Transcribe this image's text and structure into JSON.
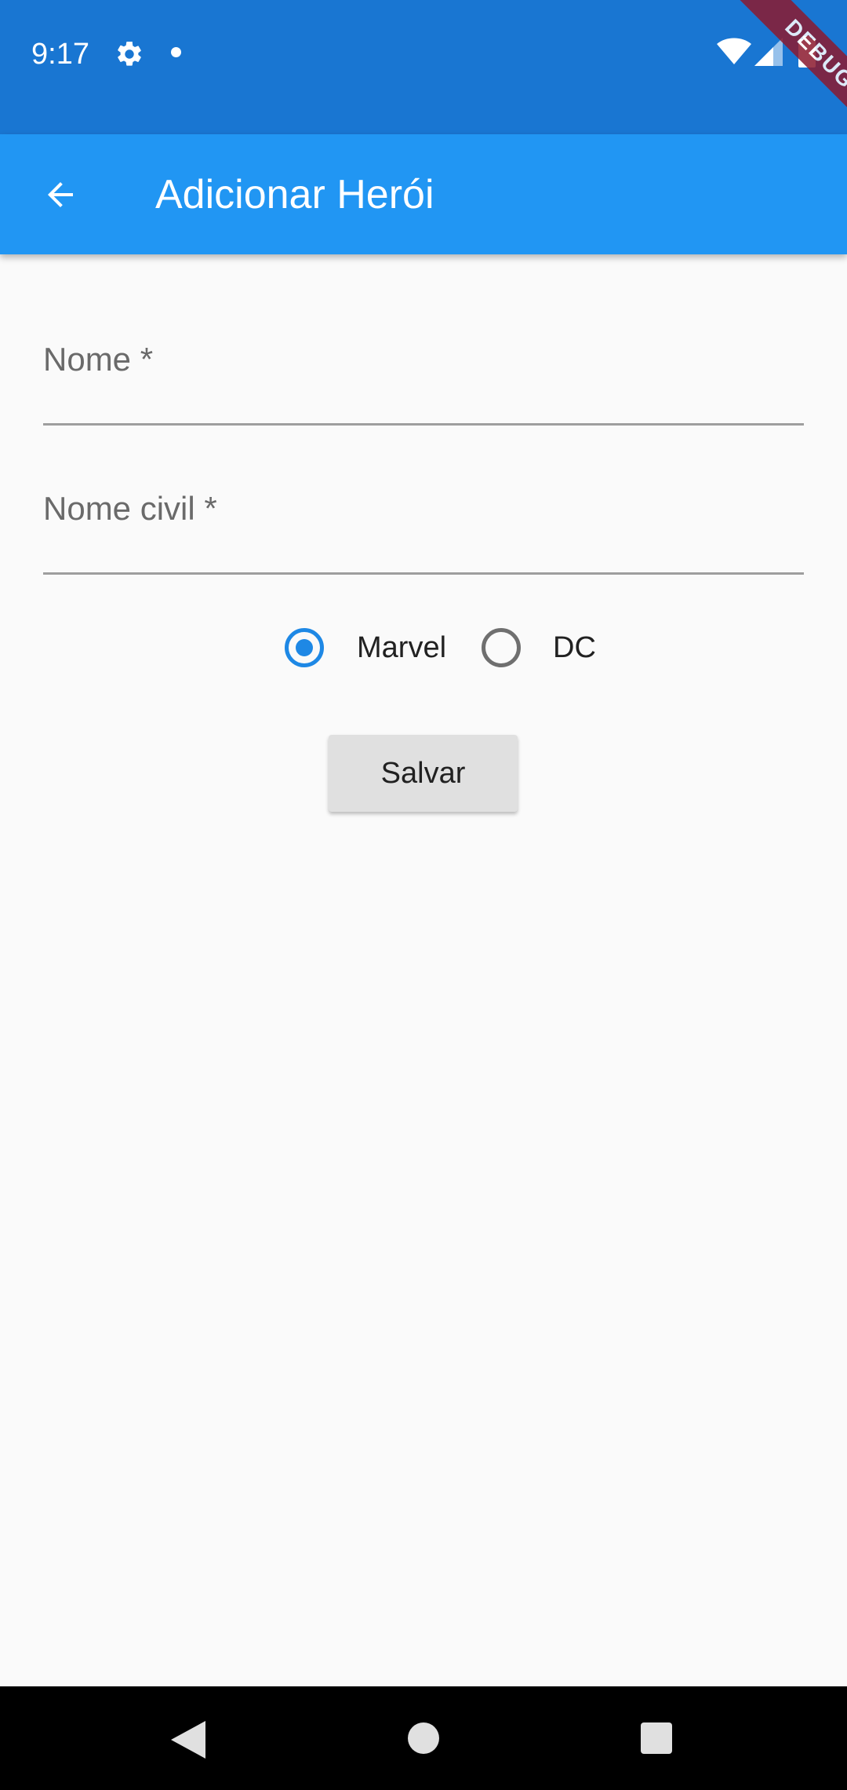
{
  "status_bar": {
    "time": "9:17",
    "icons": [
      "gear-icon",
      "notification-dot-icon",
      "wifi-icon",
      "signal-icon",
      "battery-icon"
    ]
  },
  "debug_banner": "DEBUG",
  "app_bar": {
    "title": "Adicionar Herói",
    "back_icon": "arrow-back-icon",
    "color": "#2196f3"
  },
  "form": {
    "name_field": {
      "label": "Nome *",
      "value": ""
    },
    "civil_name_field": {
      "label": "Nome civil *",
      "value": ""
    },
    "publisher": {
      "options": [
        {
          "label": "Marvel",
          "selected": true
        },
        {
          "label": "DC",
          "selected": false
        }
      ]
    },
    "save_button": "Salvar"
  },
  "nav_bar": {
    "icons": [
      "nav-back-icon",
      "nav-home-icon",
      "nav-recents-icon"
    ]
  },
  "colors": {
    "status_bar": "#1976d2",
    "accent": "#1e88e5",
    "background": "#fafafa"
  }
}
